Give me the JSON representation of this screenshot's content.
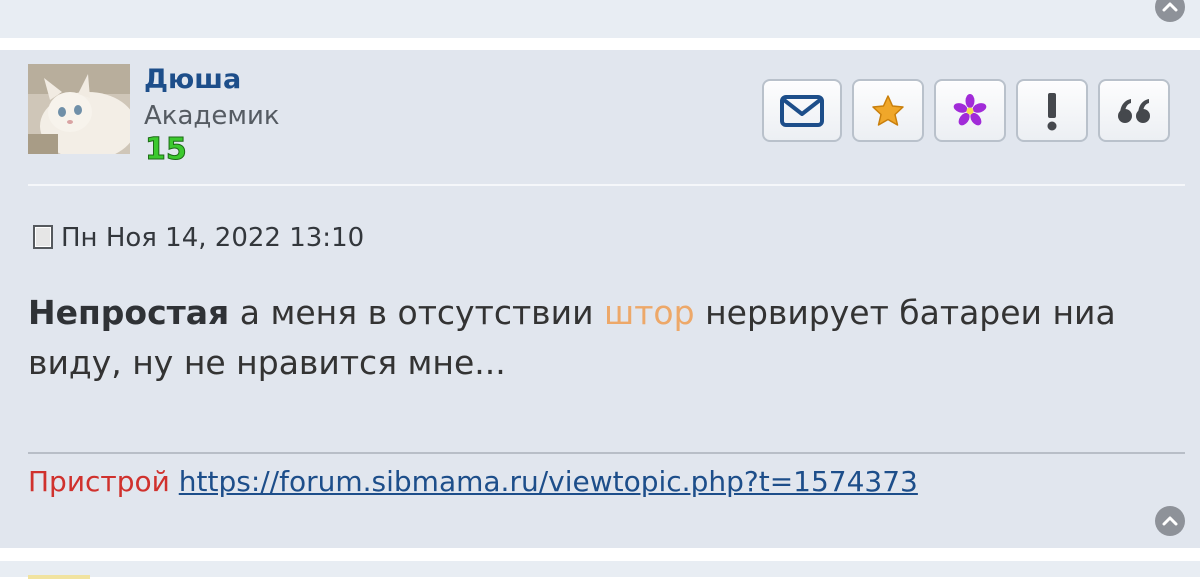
{
  "previous_post": {},
  "post": {
    "author": {
      "name": "Дюша",
      "rank": "Академик",
      "reputation": "15"
    },
    "actions": [
      {
        "name": "send-message-button",
        "icon": "envelope-icon"
      },
      {
        "name": "favorite-button",
        "icon": "star-icon"
      },
      {
        "name": "flower-button",
        "icon": "flower-icon"
      },
      {
        "name": "report-button",
        "icon": "exclamation-icon"
      },
      {
        "name": "quote-button",
        "icon": "quote-icon"
      }
    ],
    "post_icon": "post-page-icon",
    "timestamp": "Пн Ноя 14, 2022 13:10",
    "body": {
      "lead": "Непростая",
      "part1": " а меня в отсутствии ",
      "highlight": "штор",
      "part2": " нервирует батареи ниа виду, ну не нравится мне..."
    },
    "signature": {
      "label": "Пристрой",
      "link": "https://forum.sibmama.ru/viewtopic.php?t=1574373"
    },
    "back_to_top_icon": "chevron-up-icon"
  },
  "colors": {
    "username": "#1d4e8a",
    "reputation": "#3cc92e",
    "highlight": "#eda869",
    "signature_label": "#d0312d",
    "post_background": "#e1e6ee"
  }
}
